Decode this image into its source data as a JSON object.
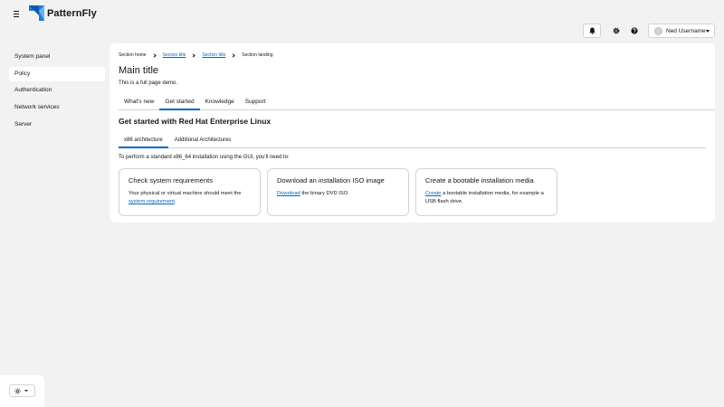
{
  "masthead": {
    "brand": "PatternFly",
    "user_name": "Ned Username"
  },
  "sidebar": {
    "items": [
      {
        "label": "System panel"
      },
      {
        "label": "Policy"
      },
      {
        "label": "Authentication"
      },
      {
        "label": "Network services"
      },
      {
        "label": "Server"
      }
    ]
  },
  "breadcrumb": [
    "Section home",
    "Section title",
    "Section title",
    "Section landing"
  ],
  "page": {
    "title": "Main title",
    "subtitle": "This is a full page demo."
  },
  "tabs": [
    "What's new",
    "Get started",
    "Knowledge",
    "Support"
  ],
  "section": {
    "title": "Get started with Red Hat Enterprise Linux",
    "subtabs": [
      "x86 architecture",
      "Additional Architectures"
    ],
    "intro": "To perform a standard x86_64 installation using the GUI, you'll need to:"
  },
  "cards": [
    {
      "title": "Check system requirements",
      "body_pre": "Your physical or virtual machine should meet the ",
      "link": "system requirement",
      "body_post": "."
    },
    {
      "title": "Download an installation ISO image",
      "link": "Download",
      "body_post": " the binary DVD ISO."
    },
    {
      "title": "Create a bootable installation media",
      "link": "Create",
      "body_post": " a bootable installation media, for example a USB flash drive."
    }
  ],
  "colors": {
    "accent": "#0066cc",
    "background": "#f2f2f2",
    "surface": "#ffffff",
    "border": "#d2d2d2"
  },
  "icons": [
    "hamburger-icon",
    "patternfly-logo-icon",
    "bell-icon",
    "gear-icon",
    "help-icon",
    "avatar",
    "chevron-down-icon",
    "chevron-right-icon",
    "sun-icon"
  ]
}
